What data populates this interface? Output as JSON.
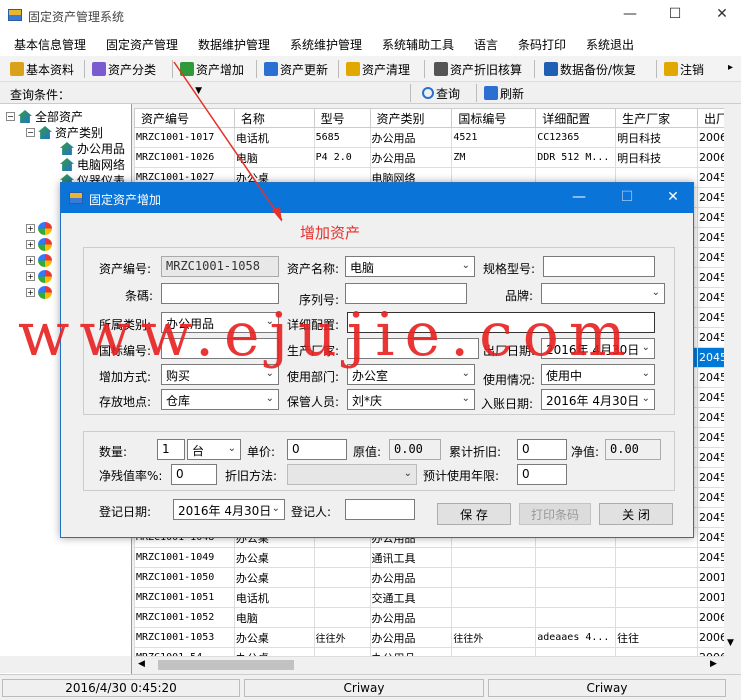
{
  "window": {
    "title": "固定资产管理系统",
    "min": "—",
    "max": "☐",
    "close": "✕"
  },
  "menu": [
    "基本信息管理",
    "固定资产管理",
    "数据维护管理",
    "系统维护管理",
    "系统辅助工具",
    "语言",
    "条码打印",
    "系统退出"
  ],
  "toolbar": [
    {
      "label": "基本资料",
      "color": "#d9a21a"
    },
    {
      "label": "资产分类",
      "color": "#7a5bd0"
    },
    {
      "label": "资产增加",
      "color": "#2f9a3a"
    },
    {
      "label": "资产更新",
      "color": "#2a6fd1"
    },
    {
      "label": "资产清理",
      "color": "#e0a800"
    },
    {
      "label": "资产折旧核算",
      "color": "#555555"
    },
    {
      "label": "数据备份/恢复",
      "color": "#1f5fb4"
    },
    {
      "label": "注销",
      "color": "#e0a800"
    }
  ],
  "query": {
    "label": "查询条件：",
    "search": "查询",
    "refresh": "刷新"
  },
  "tree": {
    "root": "全部资产",
    "category": "资产类别",
    "items": [
      "办公用品",
      "电脑网络",
      "仪器仪表"
    ]
  },
  "grid": {
    "headers": [
      "资产编号",
      "名称",
      "型号",
      "资产类别",
      "国标编号",
      "详细配置",
      "生产厂家",
      "出厂"
    ],
    "rows": [
      [
        "MRZC1001-1017",
        "电话机",
        "5685",
        "办公用品",
        "4521",
        "CC12365",
        "明日科技",
        "2006/"
      ],
      [
        "MRZC1001-1026",
        "电脑",
        "P4 2.0",
        "办公用品",
        "ZM",
        "DDR 512 M...",
        "明日科技",
        "2006/"
      ],
      [
        "MRZC1001-1027",
        "办公桌",
        "",
        "电脑网络",
        "",
        "",
        "",
        "2045/"
      ],
      [
        "",
        "",
        "",
        "",
        "",
        "",
        "",
        "2045/"
      ],
      [
        "",
        "",
        "",
        "",
        "",
        "",
        "",
        "2045/"
      ],
      [
        "",
        "",
        "",
        "",
        "",
        "",
        "",
        "2045/"
      ],
      [
        "",
        "",
        "",
        "",
        "",
        "",
        "",
        "2045/"
      ],
      [
        "",
        "",
        "",
        "",
        "",
        "",
        "",
        "2045/"
      ],
      [
        "",
        "",
        "",
        "",
        "",
        "",
        "",
        "2045/"
      ],
      [
        "",
        "",
        "",
        "",
        "",
        "",
        "",
        "2045/"
      ],
      [
        "",
        "",
        "",
        "",
        "",
        "",
        "",
        "2045/"
      ],
      [
        "",
        "",
        "",
        "",
        "",
        "",
        "",
        "2045/"
      ],
      [
        "",
        "",
        "",
        "",
        "",
        "",
        "",
        "2045/"
      ],
      [
        "",
        "",
        "",
        "",
        "",
        "",
        "",
        "2045/"
      ],
      [
        "",
        "",
        "",
        "",
        "",
        "",
        "",
        "2045/"
      ],
      [
        "",
        "",
        "",
        "",
        "",
        "",
        "",
        "2045/"
      ],
      [
        "",
        "",
        "",
        "",
        "",
        "",
        "",
        "2045/"
      ],
      [
        "",
        "",
        "",
        "",
        "",
        "",
        "",
        "2045/"
      ],
      [
        "",
        "",
        "",
        "",
        "",
        "",
        "",
        "2045/"
      ],
      [
        "",
        "",
        "",
        "",
        "",
        "",
        "",
        "2045/"
      ],
      [
        "MRZC1001-1048",
        "办公桌",
        "",
        "办公用品",
        "",
        "",
        "",
        "2045/"
      ],
      [
        "MRZC1001-1049",
        "办公桌",
        "",
        "通讯工具",
        "",
        "",
        "",
        "2045/"
      ],
      [
        "MRZC1001-1050",
        "办公桌",
        "",
        "办公用品",
        "",
        "",
        "",
        "2001/"
      ],
      [
        "MRZC1001-1051",
        "电话机",
        "",
        "交通工具",
        "",
        "",
        "",
        "2001/"
      ],
      [
        "MRZC1001-1052",
        "电脑",
        "",
        "办公用品",
        "",
        "",
        "",
        "2006/"
      ],
      [
        "MRZC1001-1053",
        "办公桌",
        "往往外",
        "办公用品",
        "往往外",
        "adeaaes 4...",
        "往往",
        "2006/"
      ],
      [
        "MRZC1001-54",
        "办公桌",
        "",
        "办公用品",
        "",
        "",
        "",
        "2006/"
      ]
    ],
    "selected_row": 11
  },
  "status": {
    "datetime": "2016/4/30 0:45:20",
    "user1": "Criway",
    "user2": "Criway"
  },
  "dialog": {
    "title": "固定资产增加",
    "fields": {
      "asset_no_label": "资产编号:",
      "asset_no": "MRZC1001-1058",
      "asset_name_label": "资产名称:",
      "asset_name": "电脑",
      "spec_label": "规格型号:",
      "spec": "",
      "barcode_label": "条碼:",
      "barcode": "",
      "serial_label": "序列号:",
      "serial": "",
      "brand_label": "品牌:",
      "brand": "",
      "category_label": "所属类别:",
      "category": "办公用品",
      "config_label": "详细配置:",
      "config": "",
      "gb_label": "国标编号:",
      "gb": "",
      "maker_label": "生产厂家:",
      "maker": "",
      "mfg_date_label": "出厂日期:",
      "mfg_date": "2016年  4月30日",
      "add_method_label": "增加方式:",
      "add_method": "购买",
      "dept_label": "使用部门:",
      "dept": "办公室",
      "usage_label": "使用情况:",
      "usage": "使用中",
      "location_label": "存放地点:",
      "location": "仓库",
      "keeper_label": "保管人员:",
      "keeper": "刘*庆",
      "entry_date_label": "入账日期:",
      "entry_date": "2016年  4月30日",
      "qty_label": "数量:",
      "qty": "1",
      "unit": "台",
      "price_label": "单价:",
      "price": "0",
      "orig_label": "原值:",
      "orig": "0.00",
      "accum_label": "累计折旧:",
      "accum": "0",
      "net_label": "净值:",
      "net": "0.00",
      "residual_label": "净残值率%:",
      "residual": "0",
      "dep_method_label": "折旧方法:",
      "dep_method": "",
      "life_label": "预计使用年限:",
      "life": "0",
      "reg_date_label": "登记日期:",
      "reg_date": "2016年  4月30日",
      "registrar_label": "登记人:",
      "registrar": ""
    },
    "buttons": {
      "save": "保  存",
      "print": "打印条码",
      "close": "关  闭"
    }
  },
  "annotation": "增加资产",
  "watermark": "www.ejujie.com"
}
